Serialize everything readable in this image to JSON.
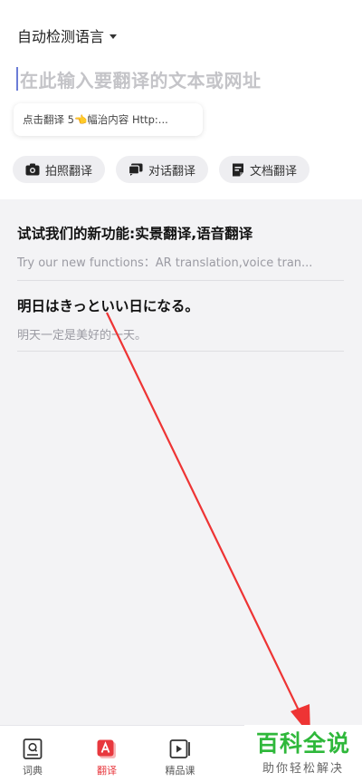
{
  "header": {
    "language_select": "自动检测语言"
  },
  "input": {
    "placeholder": "在此输入要翻译的文本或网址"
  },
  "hint": {
    "text": "点击翻译 5👈幅治内容 Http:..."
  },
  "actions": [
    {
      "label": "拍照翻译",
      "icon": "camera-icon"
    },
    {
      "label": "对话翻译",
      "icon": "chat-icon"
    },
    {
      "label": "文档翻译",
      "icon": "document-icon"
    }
  ],
  "history": [
    {
      "title": "试试我们的新功能:实景翻译,语音翻译",
      "subtitle": "Try our new functions：AR translation,voice tran..."
    },
    {
      "title": "明日はきっといい日になる。",
      "subtitle": "明天一定是美好的一天。"
    }
  ],
  "tabs": [
    {
      "label": "词典",
      "icon": "dictionary-icon"
    },
    {
      "label": "翻译",
      "icon": "translate-icon",
      "active": true
    },
    {
      "label": "精品课",
      "icon": "video-course-icon"
    }
  ],
  "watermark": {
    "title": "百科全说",
    "subtitle": "助你轻松解决"
  },
  "colors": {
    "accent": "#e8383e",
    "annotation_arrow": "#ee3434",
    "watermark_green": "#2fb83b"
  }
}
